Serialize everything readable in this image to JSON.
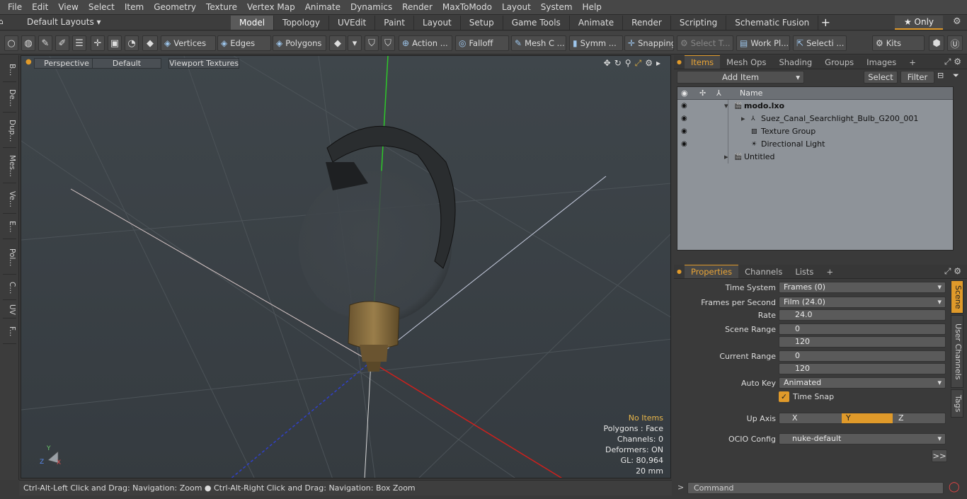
{
  "menu": [
    "File",
    "Edit",
    "View",
    "Select",
    "Item",
    "Geometry",
    "Texture",
    "Vertex Map",
    "Animate",
    "Dynamics",
    "Render",
    "MaxToModo",
    "Layout",
    "System",
    "Help"
  ],
  "layout_selector": "Default Layouts ▾",
  "mode_tabs": [
    "Model",
    "Topology",
    "UVEdit",
    "Paint",
    "Layout",
    "Setup",
    "Game Tools",
    "Animate",
    "Render",
    "Scripting",
    "Schematic Fusion"
  ],
  "mode_tab_active": "Model",
  "only_button": "★ Only",
  "toolbar": {
    "vertices": "Vertices",
    "edges": "Edges",
    "polygons": "Polygons",
    "action": "Action ...",
    "falloff": "Falloff",
    "mesh": "Mesh C ...",
    "symm": "Symm ...",
    "snapping": "Snapping",
    "select_t": "Select T...",
    "work_plane": "Work Pl...",
    "selecti": "Selecti ...",
    "kits": "Kits"
  },
  "left_tabs": [
    "B...",
    "De...",
    "Dup...",
    "Mes...",
    "Ve...",
    "E...",
    "Pol...",
    "C...",
    "UV",
    "F..."
  ],
  "viewport": {
    "view": "Perspective",
    "shading": "Default",
    "textures": "Viewport Textures",
    "info": {
      "items": "No Items",
      "polygons": "Polygons : Face",
      "channels": "Channels: 0",
      "deformers": "Deformers: ON",
      "gl": "GL: 80,964",
      "scale": "20 mm"
    },
    "axis_x": "X",
    "axis_y": "Y",
    "axis_z": "Z"
  },
  "status_text": "Ctrl-Alt-Left Click and Drag: Navigation: Zoom ● Ctrl-Alt-Right Click and Drag: Navigation: Box Zoom",
  "items_panel": {
    "tabs": [
      "Items",
      "Mesh Ops",
      "Shading",
      "Groups",
      "Images"
    ],
    "add_item": "Add Item",
    "select": "Select",
    "filter": "Filter",
    "col_name": "Name",
    "rows": [
      {
        "label": "modo.lxo",
        "indent": 0
      },
      {
        "label": "Suez_Canal_Searchlight_Bulb_G200_001",
        "indent": 1
      },
      {
        "label": "Texture Group",
        "indent": 1
      },
      {
        "label": "Directional Light",
        "indent": 1
      },
      {
        "label": "Untitled",
        "indent": 0
      }
    ]
  },
  "props_panel": {
    "tabs": [
      "Properties",
      "Channels",
      "Lists"
    ],
    "time_system_label": "Time System",
    "time_system": "Frames (0)",
    "fps_label": "Frames per Second",
    "fps": "Film (24.0)",
    "rate_label": "Rate",
    "rate": "24.0",
    "scene_range_label": "Scene Range",
    "scene_start": "0",
    "scene_end": "120",
    "current_range_label": "Current Range",
    "current_start": "0",
    "current_end": "120",
    "auto_key_label": "Auto Key",
    "auto_key": "Animated",
    "time_snap": "Time Snap",
    "up_axis_label": "Up Axis",
    "up_x": "X",
    "up_y": "Y",
    "up_z": "Z",
    "ocio_label": "OCIO Config",
    "ocio": "nuke-default",
    "side_tabs": [
      "Scene",
      "User Channels",
      "Tags"
    ]
  },
  "command_placeholder": "Command",
  "colors": {
    "accent": "#e09a2a",
    "viewport_bg": "#3b4146"
  }
}
